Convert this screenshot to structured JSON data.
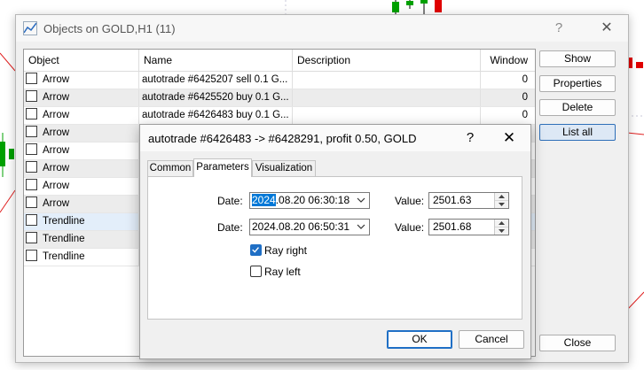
{
  "main_window": {
    "title": "Objects on GOLD,H1 (11)",
    "help_glyph": "?",
    "close_glyph": "✕",
    "icon": "chart-line-icon"
  },
  "table": {
    "columns": [
      "Object",
      "Name",
      "Description",
      "Window"
    ],
    "rows": [
      {
        "object": "Arrow",
        "name": "autotrade #6425207 sell 0.1 G...",
        "description": "",
        "window": "0"
      },
      {
        "object": "Arrow",
        "name": "autotrade #6425520 buy 0.1 G...",
        "description": "",
        "window": "0"
      },
      {
        "object": "Arrow",
        "name": "autotrade #6426483 buy 0.1 G...",
        "description": "",
        "window": "0"
      },
      {
        "object": "Arrow",
        "name": "",
        "description": "",
        "window": ""
      },
      {
        "object": "Arrow",
        "name": "",
        "description": "",
        "window": ""
      },
      {
        "object": "Arrow",
        "name": "",
        "description": "",
        "window": ""
      },
      {
        "object": "Arrow",
        "name": "",
        "description": "",
        "window": ""
      },
      {
        "object": "Arrow",
        "name": "",
        "description": "",
        "window": ""
      },
      {
        "object": "Trendline",
        "name": "",
        "description": "",
        "window": ""
      },
      {
        "object": "Trendline",
        "name": "",
        "description": "",
        "window": ""
      },
      {
        "object": "Trendline",
        "name": "",
        "description": "",
        "window": ""
      }
    ]
  },
  "side_buttons": {
    "show": "Show",
    "properties": "Properties",
    "delete": "Delete",
    "list_all": "List all",
    "close": "Close"
  },
  "dialog": {
    "title": "autotrade #6426483 -> #6428291, profit 0.50, GOLD",
    "help_glyph": "?",
    "close_glyph": "✕",
    "tabs": [
      "Common",
      "Parameters",
      "Visualization"
    ],
    "active_tab": "Parameters",
    "date_label": "Date:",
    "value_label": "Value:",
    "point1": {
      "date_year": "2024",
      "date_rest": ".08.20 06:30:18",
      "value": "2501.63"
    },
    "point2": {
      "date": "2024.08.20 06:50:31",
      "value": "2501.68"
    },
    "ray_right": {
      "label": "Ray right",
      "checked": true
    },
    "ray_left": {
      "label": "Ray left",
      "checked": false
    },
    "ok": "OK",
    "cancel": "Cancel"
  },
  "colors": {
    "accent": "#1f6fc5",
    "selection": "#0078d7",
    "candle_up": "#00a000",
    "candle_down": "#e00000"
  }
}
